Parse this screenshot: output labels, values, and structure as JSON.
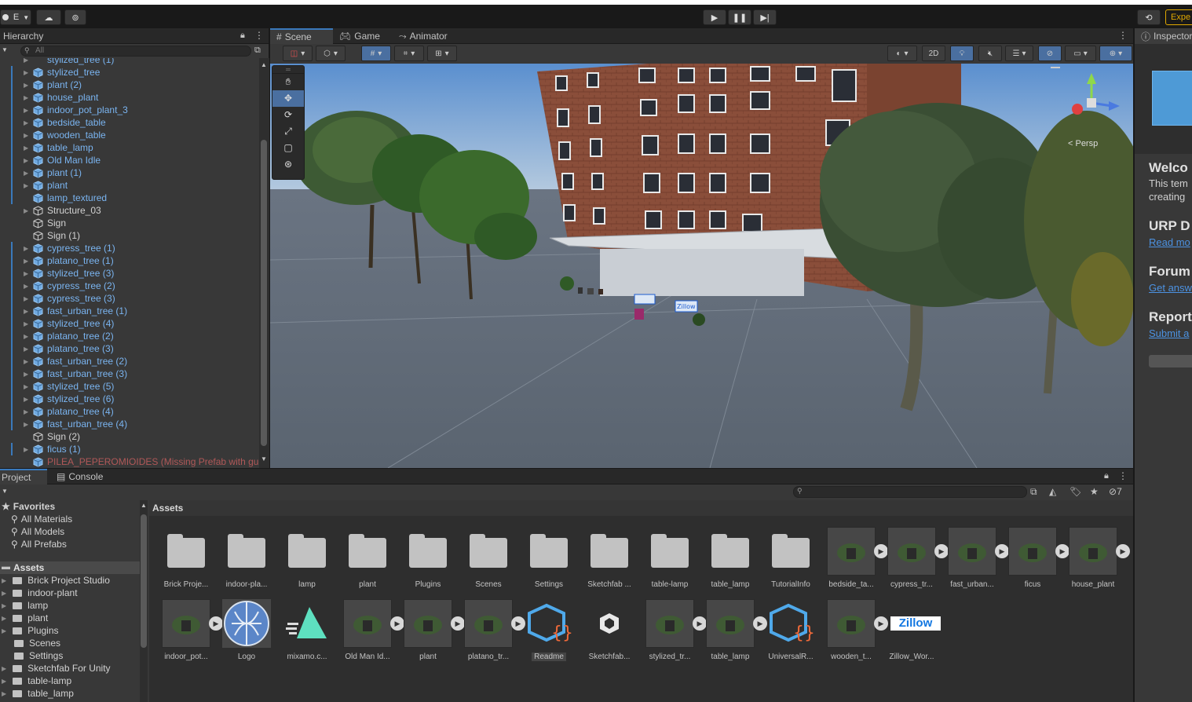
{
  "toolbar": {
    "account_label": "E",
    "experimental_label": "Expe"
  },
  "hierarchy": {
    "tab_label": "Hierarchy",
    "search_placeholder": "All",
    "items": [
      {
        "label": "stylized_tree",
        "color": "blue",
        "arrow": true
      },
      {
        "label": "plant (2)",
        "color": "blue",
        "arrow": true
      },
      {
        "label": "house_plant",
        "color": "blue",
        "arrow": true
      },
      {
        "label": "indoor_pot_plant_3",
        "color": "blue",
        "arrow": true
      },
      {
        "label": "bedside_table",
        "color": "blue",
        "arrow": true
      },
      {
        "label": "wooden_table",
        "color": "blue",
        "arrow": true
      },
      {
        "label": "table_lamp",
        "color": "blue",
        "arrow": true
      },
      {
        "label": "Old Man Idle",
        "color": "blue",
        "arrow": true
      },
      {
        "label": "plant (1)",
        "color": "blue",
        "arrow": true
      },
      {
        "label": "plant",
        "color": "blue",
        "arrow": true
      },
      {
        "label": "lamp_textured",
        "color": "blue",
        "arrow": false
      },
      {
        "label": "Structure_03",
        "color": "white",
        "arrow": true
      },
      {
        "label": "Sign",
        "color": "white",
        "arrow": false
      },
      {
        "label": "Sign (1)",
        "color": "white",
        "arrow": false
      },
      {
        "label": "cypress_tree (1)",
        "color": "blue",
        "arrow": true
      },
      {
        "label": "platano_tree (1)",
        "color": "blue",
        "arrow": true
      },
      {
        "label": "stylized_tree (3)",
        "color": "blue",
        "arrow": true
      },
      {
        "label": "cypress_tree (2)",
        "color": "blue",
        "arrow": true
      },
      {
        "label": "cypress_tree (3)",
        "color": "blue",
        "arrow": true
      },
      {
        "label": "fast_urban_tree (1)",
        "color": "blue",
        "arrow": true
      },
      {
        "label": "stylized_tree (4)",
        "color": "blue",
        "arrow": true
      },
      {
        "label": "platano_tree (2)",
        "color": "blue",
        "arrow": true
      },
      {
        "label": "platano_tree (3)",
        "color": "blue",
        "arrow": true
      },
      {
        "label": "fast_urban_tree (2)",
        "color": "blue",
        "arrow": true
      },
      {
        "label": "fast_urban_tree (3)",
        "color": "blue",
        "arrow": true
      },
      {
        "label": "stylized_tree (5)",
        "color": "blue",
        "arrow": true
      },
      {
        "label": "stylized_tree (6)",
        "color": "blue",
        "arrow": true
      },
      {
        "label": "platano_tree (4)",
        "color": "blue",
        "arrow": true
      },
      {
        "label": "fast_urban_tree (4)",
        "color": "blue",
        "arrow": true
      },
      {
        "label": "Sign (2)",
        "color": "white",
        "arrow": false
      },
      {
        "label": "ficus (1)",
        "color": "blue",
        "arrow": true
      },
      {
        "label": "PILEA_PEPEROMIOIDES (Missing Prefab with gu",
        "color": "red",
        "arrow": false
      }
    ]
  },
  "scene": {
    "tabs": [
      "Scene",
      "Game",
      "Animator"
    ],
    "btn_2d": "2D",
    "persp_label": "< Persp",
    "sign_text": "Zillow"
  },
  "inspector": {
    "tab_label": "Inspector",
    "headings": [
      {
        "title": "Welco",
        "body1": "This tem",
        "body2": "creating"
      },
      {
        "title": "URP D",
        "link": "Read mo"
      },
      {
        "title": "Forum",
        "link": "Get answ"
      },
      {
        "title": "Report",
        "link": "Submit a"
      }
    ]
  },
  "project": {
    "tabs": [
      "Project",
      "Console"
    ],
    "hidden_count": "7",
    "assets_header": "Assets",
    "favorites": {
      "title": "Favorites",
      "items": [
        "All Materials",
        "All Models",
        "All Prefabs"
      ]
    },
    "tree": {
      "title": "Assets",
      "items": [
        "Brick Project Studio",
        "indoor-plant",
        "lamp",
        "plant",
        "Plugins",
        "Scenes",
        "Settings",
        "Sketchfab For Unity",
        "table-lamp",
        "table_lamp"
      ]
    },
    "grid_row1": [
      {
        "name": "Brick Proje...",
        "kind": "folder"
      },
      {
        "name": "indoor-pla...",
        "kind": "folder"
      },
      {
        "name": "lamp",
        "kind": "folder"
      },
      {
        "name": "plant",
        "kind": "folder"
      },
      {
        "name": "Plugins",
        "kind": "folder"
      },
      {
        "name": "Scenes",
        "kind": "folder"
      },
      {
        "name": "Settings",
        "kind": "folder"
      },
      {
        "name": "Sketchfab ...",
        "kind": "folder"
      },
      {
        "name": "table-lamp",
        "kind": "folder"
      },
      {
        "name": "table_lamp",
        "kind": "folder"
      },
      {
        "name": "TutorialInfo",
        "kind": "folder"
      },
      {
        "name": "bedside_ta...",
        "kind": "prefab"
      },
      {
        "name": "cypress_tr...",
        "kind": "prefab"
      },
      {
        "name": "fast_urban...",
        "kind": "prefab"
      },
      {
        "name": "ficus",
        "kind": "prefab"
      },
      {
        "name": "house_plant",
        "kind": "prefab"
      }
    ],
    "grid_row2": [
      {
        "name": "indoor_pot...",
        "kind": "prefab"
      },
      {
        "name": "Logo",
        "kind": "logo"
      },
      {
        "name": "mixamo.c...",
        "kind": "mixamo"
      },
      {
        "name": "Old Man Id...",
        "kind": "prefab"
      },
      {
        "name": "plant",
        "kind": "prefab"
      },
      {
        "name": "platano_tr...",
        "kind": "prefab"
      },
      {
        "name": "Readme",
        "kind": "script"
      },
      {
        "name": "Sketchfab...",
        "kind": "unity"
      },
      {
        "name": "stylized_tr...",
        "kind": "prefab"
      },
      {
        "name": "table_lamp",
        "kind": "prefab"
      },
      {
        "name": "UniversalR...",
        "kind": "script"
      },
      {
        "name": "wooden_t...",
        "kind": "prefab"
      },
      {
        "name": "Zillow_Wor...",
        "kind": "zillow"
      }
    ],
    "zillow_label": "Zillow"
  }
}
